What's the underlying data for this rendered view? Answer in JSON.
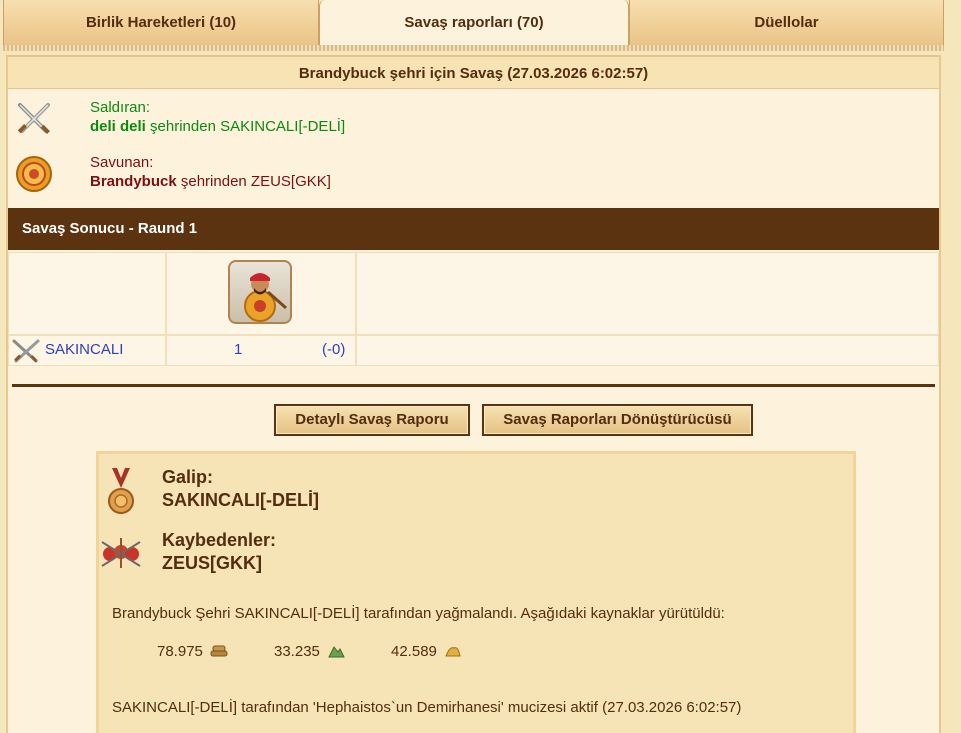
{
  "tabs": [
    {
      "label": "Birlik Hareketleri (10)",
      "active": false
    },
    {
      "label": "Savaş raporları (70)",
      "active": true
    },
    {
      "label": "Düellolar",
      "active": false
    }
  ],
  "report": {
    "title": "Brandybuck şehri için Savaş (27.03.2026 6:02:57)",
    "attacker": {
      "label": "Saldıran:",
      "city": "deli deli",
      "text": " şehrinden SAKINCALI[-DELİ]",
      "icon": "crossed-swords-icon"
    },
    "defender": {
      "label": "Savunan:",
      "city": "Brandybuck",
      "text": " şehrinden ZEUS[GKK]",
      "icon": "shield-icon"
    },
    "round_title": "Savaş Sonucu - Raund 1",
    "unit_row": {
      "player": "SAKINCALI",
      "count": "1",
      "loss": "(-0)",
      "unit_icon": "hoplite-unit-icon"
    },
    "buttons": {
      "detail": "Detaylı Savaş Raporu",
      "converter": "Savaş Raporları Dönüştürücüsü"
    },
    "result": {
      "winner_label": "Galip:",
      "winner": "SAKINCALI[-DELİ]",
      "loser_label": "Kaybedenler:",
      "loser": "ZEUS[GKK]",
      "pillage_text": "Brandybuck Şehri SAKINCALI[-DELİ] tarafından yağmalandı. Aşağıdaki kaynaklar yürütüldü:",
      "resources": [
        {
          "amount": "78.975",
          "icon": "wood-icon"
        },
        {
          "amount": "33.235",
          "icon": "marble-icon"
        },
        {
          "amount": "42.589",
          "icon": "wine-icon"
        }
      ],
      "wonder_text": "SAKINCALI[-DELİ] tarafından 'Hephaistos`un Demirhanesi' mucizesi aktif (27.03.2026 6:02:57)"
    }
  },
  "colors": {
    "dark_brown": "#5b3310",
    "attacker_green": "#0d8a0d",
    "defender_red": "#7a1010",
    "link_blue": "#2f3fbf"
  }
}
